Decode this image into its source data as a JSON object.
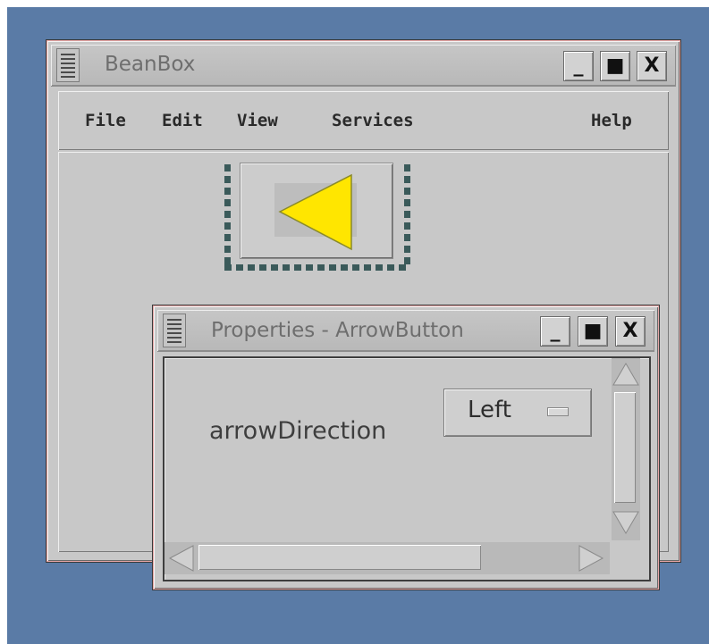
{
  "beanbox": {
    "title": "BeanBox",
    "menus": [
      "File",
      "Edit",
      "View",
      "Services",
      "Help"
    ],
    "buttons": {
      "minimize": "_",
      "maximize": "■",
      "close": "X"
    }
  },
  "canvas": {
    "bean": {
      "name": "ArrowButton",
      "arrow_color": "#ffe600",
      "arrow_direction_icon": "left-arrow-icon"
    }
  },
  "properties": {
    "title": "Properties - ArrowButton",
    "buttons": {
      "minimize": "_",
      "maximize": "■",
      "close": "X"
    },
    "rows": [
      {
        "label": "arrowDirection",
        "value": "Left"
      }
    ]
  },
  "colors": {
    "desktop": "#5a7ba6",
    "window": "#c8c8c8",
    "arrow": "#ffe600"
  }
}
